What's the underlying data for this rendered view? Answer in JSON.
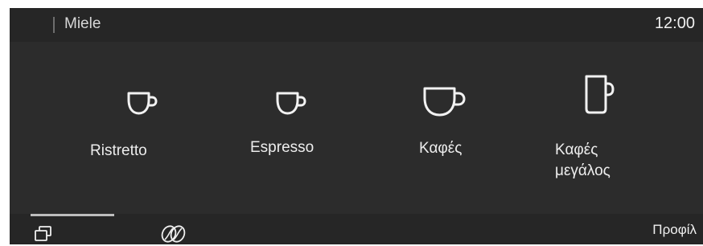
{
  "header": {
    "brand": "Miele",
    "time": "12:00"
  },
  "drinks": [
    {
      "label": "Ristretto",
      "icon": "small-cup-icon"
    },
    {
      "label": "Espresso",
      "icon": "small-cup-icon"
    },
    {
      "label": "Καφές",
      "icon": "coffee-cup-icon"
    },
    {
      "label_line1": "Καφές",
      "label_line2": "μεγάλος",
      "icon": "large-mug-icon"
    }
  ],
  "bottom": {
    "profile_label": "Προφίλ",
    "icons": [
      "cups-icon",
      "coffee-beans-icon"
    ]
  },
  "colors": {
    "background": "#2c2c2c",
    "bars": "#262626",
    "text": "#ededed"
  }
}
